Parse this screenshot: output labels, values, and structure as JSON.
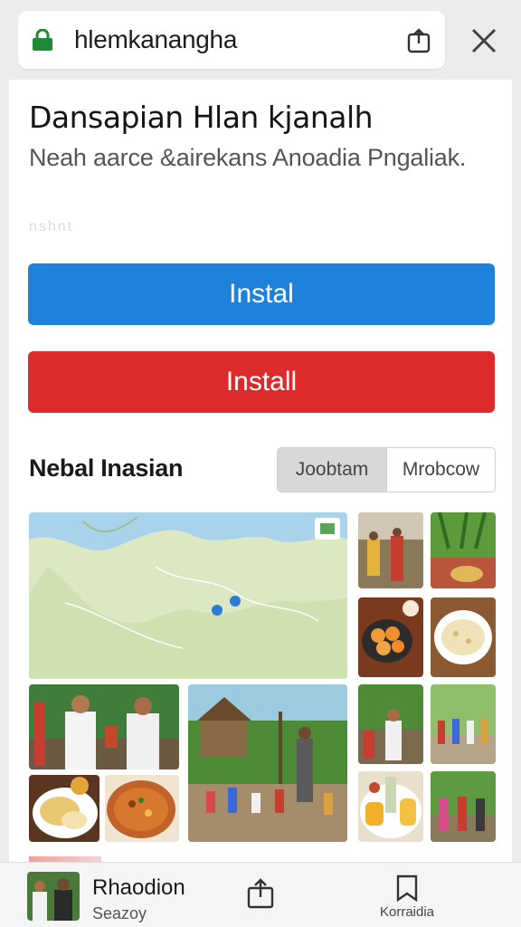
{
  "browser": {
    "url": "hlemkanangha"
  },
  "page": {
    "title": "Dansapian Hlan kjanalh",
    "subtitle": "Neah aarce &airekans Anoadia Pngaliak.",
    "faint_text": "nshnt"
  },
  "buttons": {
    "primary_label": "Instal",
    "secondary_label": "Install"
  },
  "section": {
    "title": "Nebal Inasian",
    "toggle": {
      "selected": "Joobtam",
      "other": "Mrobcow"
    }
  },
  "bottom_bar": {
    "app_name": "Rhaodion",
    "app_subtitle": "Seazoy",
    "bookmark_label": "Korraidia"
  },
  "colors": {
    "primary_button": "#1e82dc",
    "secondary_button": "#dd2a2a",
    "lock": "#1f8a3a"
  },
  "icons": {
    "lock": "lock-icon",
    "share_top": "share-icon",
    "close": "close-icon",
    "share_bottom": "share-icon",
    "bookmark": "bookmark-icon"
  }
}
